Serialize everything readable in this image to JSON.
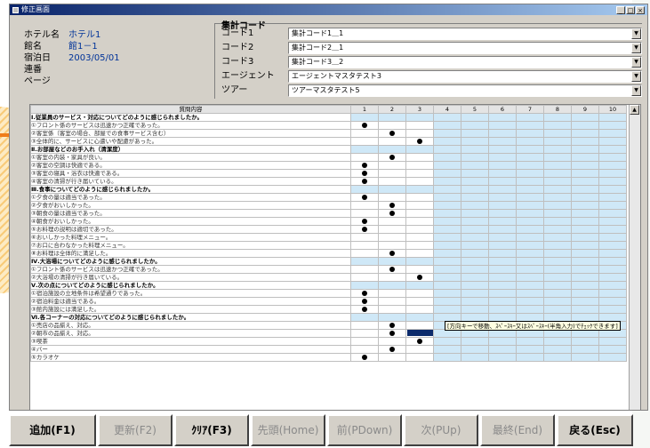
{
  "window": {
    "title": "修正画面",
    "controls": [
      "_",
      "□",
      "×"
    ]
  },
  "info": [
    {
      "label": "ホテル名",
      "value": "ホテル1"
    },
    {
      "label": "館名",
      "value": "館1－1"
    },
    {
      "label": "宿泊日",
      "value": "2003/05/01"
    },
    {
      "label": "連番",
      "value": ""
    },
    {
      "label": "ページ",
      "value": ""
    }
  ],
  "codes": {
    "title": "集計コード",
    "rows": [
      {
        "label": "コード1",
        "value": "集計コード1＿1"
      },
      {
        "label": "コード2",
        "value": "集計コード2＿1"
      },
      {
        "label": "コード3",
        "value": "集計コード3＿2"
      },
      {
        "label": "エージェント",
        "value": "エージェントマスタテスト3"
      },
      {
        "label": "ツアー",
        "value": "ツアーマスタテスト5"
      }
    ]
  },
  "grid": {
    "question_header": "質問内容",
    "columns": [
      "1",
      "2",
      "3",
      "4",
      "5",
      "6",
      "7",
      "8",
      "9",
      "10"
    ],
    "rows": [
      {
        "text": "Ⅰ.従業員のサービス・対応についてどのように感じられましたか。",
        "section": true,
        "answer": null
      },
      {
        "text": "①フロント係のサービスは迅速かつ正確であった。",
        "section": false,
        "answer": 1
      },
      {
        "text": "②客室係（客室の場合、部屋での食事サービス含む）",
        "section": false,
        "answer": 2
      },
      {
        "text": "③全体的に、サービスに心遣いや配慮があった。",
        "section": false,
        "answer": 3
      },
      {
        "text": "Ⅱ.お部屋などのお手入れ（清潔度）",
        "section": true,
        "answer": null
      },
      {
        "text": "①客室の内装・家具が良い。",
        "section": false,
        "answer": 2
      },
      {
        "text": "②客室の空調は快適である。",
        "section": false,
        "answer": 1
      },
      {
        "text": "③客室の寝具・浴衣は快適である。",
        "section": false,
        "answer": 1
      },
      {
        "text": "④客室の清掃が行き届いている。",
        "section": false,
        "answer": 1
      },
      {
        "text": "Ⅲ.食事についてどのように感じられましたか。",
        "section": true,
        "answer": null
      },
      {
        "text": "①夕食の量は適当であった。",
        "section": false,
        "answer": 1
      },
      {
        "text": "②夕食がおいしかった。",
        "section": false,
        "answer": 2
      },
      {
        "text": "③朝食の量は適当であった。",
        "section": false,
        "answer": 2
      },
      {
        "text": "④朝食がおいしかった。",
        "section": false,
        "answer": 1
      },
      {
        "text": "⑤お料理の説明は適切であった。",
        "section": false,
        "answer": 1
      },
      {
        "text": "⑥おいしかった料理メニュー。",
        "section": false,
        "answer": null
      },
      {
        "text": "⑦お口に合わなかった料理メニュー。",
        "section": false,
        "answer": null
      },
      {
        "text": "⑧お料理は全体的に満足した。",
        "section": false,
        "answer": 2
      },
      {
        "text": "Ⅳ.大浴場についてどのように感じられましたか。",
        "section": true,
        "answer": null
      },
      {
        "text": "①フロント係のサービスは迅速かつ正確であった。",
        "section": false,
        "answer": 2
      },
      {
        "text": "②大浴場の清掃が行き届いている。",
        "section": false,
        "answer": 3
      },
      {
        "text": "Ⅴ.次の点についてどのように感じられましたか。",
        "section": true,
        "answer": null
      },
      {
        "text": "①宿泊施設の立地条件は希望通りであった。",
        "section": false,
        "answer": 1
      },
      {
        "text": "②宿泊料金は適当である。",
        "section": false,
        "answer": 1
      },
      {
        "text": "③館内施設には満足した。",
        "section": false,
        "answer": 1
      },
      {
        "text": "Ⅵ.各コーナーの対応についてどのように感じられましたか。",
        "section": true,
        "answer": null
      },
      {
        "text": "①売店の品揃え、対応。",
        "section": false,
        "answer": 2
      },
      {
        "text": "②朝市の品揃え、対応。",
        "section": false,
        "answer": 2,
        "selected_col": 3
      },
      {
        "text": "③喫茶",
        "section": false,
        "answer": 3
      },
      {
        "text": "④バー",
        "section": false,
        "answer": 2
      },
      {
        "text": "⑤カラオケ",
        "section": false,
        "answer": 1
      }
    ]
  },
  "tooltip": "[方向キーで移動、ｽﾍﾟｰｽｷｰ又はｽﾍﾟｰｽｷｰ(半角入力)でﾁｪｯｸできます]",
  "footer": [
    {
      "label": "追加(F1)",
      "enabled": true
    },
    {
      "label": "更新(F2)",
      "enabled": false
    },
    {
      "label": "ｸﾘｱ(F3)",
      "enabled": true
    },
    {
      "label": "先頭(Home)",
      "enabled": false
    },
    {
      "label": "前(PDown)",
      "enabled": false
    },
    {
      "label": "次(PUp)",
      "enabled": false
    },
    {
      "label": "最終(End)",
      "enabled": false
    },
    {
      "label": "戻る(Esc)",
      "enabled": true
    }
  ],
  "colors": {
    "title_bar": "#0a246a",
    "cell_blue": "#cfe8f7",
    "selection": "#0b2a6b",
    "value_text": "#003399"
  }
}
